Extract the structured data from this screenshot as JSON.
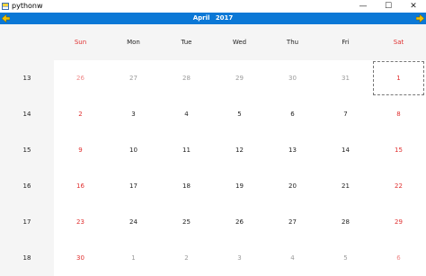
{
  "window": {
    "title": "pythonw",
    "icon": "python-app-icon",
    "controls": {
      "minimize": "—",
      "maximize": "☐",
      "close": "✕"
    }
  },
  "nav": {
    "month": "April",
    "year": "2017",
    "prev_icon": "arrow-left-icon",
    "next_icon": "arrow-right-icon",
    "bar_color": "#0b78d6",
    "arrow_color": "#f0c000"
  },
  "calendar": {
    "weekend_color": "#e03030",
    "day_names": [
      "Sun",
      "Mon",
      "Tue",
      "Wed",
      "Thu",
      "Fri",
      "Sat"
    ],
    "weeks": [
      {
        "week": "13",
        "days": [
          "26",
          "27",
          "28",
          "29",
          "30",
          "31",
          "1"
        ]
      },
      {
        "week": "14",
        "days": [
          "2",
          "3",
          "4",
          "5",
          "6",
          "7",
          "8"
        ]
      },
      {
        "week": "15",
        "days": [
          "9",
          "10",
          "11",
          "12",
          "13",
          "14",
          "15"
        ]
      },
      {
        "week": "16",
        "days": [
          "16",
          "17",
          "18",
          "19",
          "20",
          "21",
          "22"
        ]
      },
      {
        "week": "17",
        "days": [
          "23",
          "24",
          "25",
          "26",
          "27",
          "28",
          "29"
        ]
      },
      {
        "week": "18",
        "days": [
          "30",
          "1",
          "2",
          "3",
          "4",
          "5",
          "6"
        ]
      }
    ],
    "other_month_cells": [
      [
        0,
        0
      ],
      [
        0,
        1
      ],
      [
        0,
        2
      ],
      [
        0,
        3
      ],
      [
        0,
        4
      ],
      [
        0,
        5
      ],
      [
        5,
        1
      ],
      [
        5,
        2
      ],
      [
        5,
        3
      ],
      [
        5,
        4
      ],
      [
        5,
        5
      ],
      [
        5,
        6
      ]
    ],
    "selected_cell": [
      0,
      6
    ]
  }
}
